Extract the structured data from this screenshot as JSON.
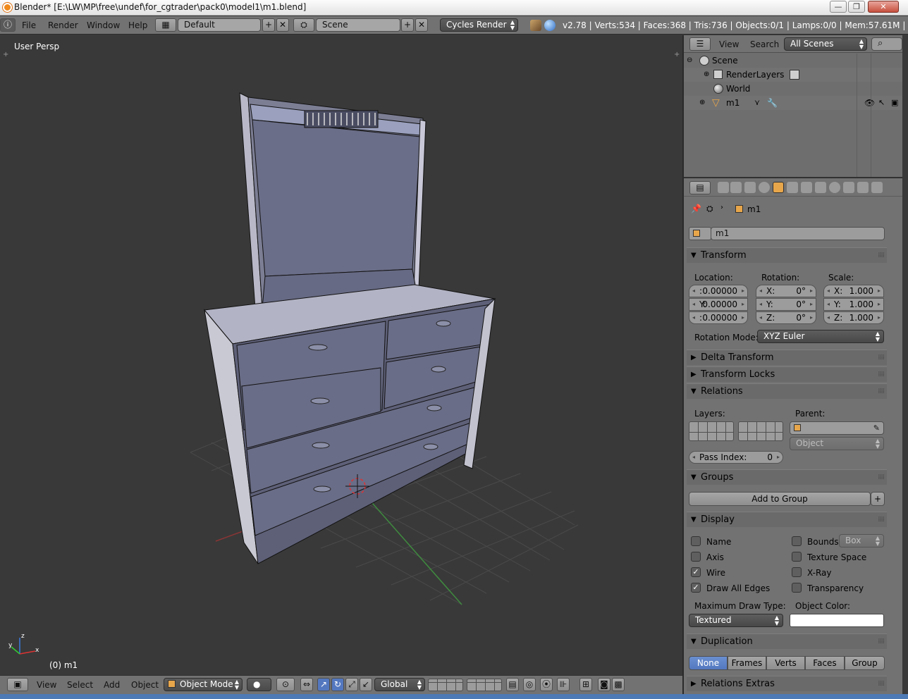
{
  "window": {
    "title": "Blender* [E:\\LW\\MP\\free\\undef\\for_cgtrader\\pack0\\model1\\m1.blend]",
    "min_label": "—",
    "max_label": "❐",
    "close_label": "✕"
  },
  "info_header": {
    "menus": [
      "File",
      "Render",
      "Window",
      "Help"
    ],
    "screen_layout": "Default",
    "scene": "Scene",
    "render_engine": "Cycles Render",
    "stats": "v2.78 | Verts:534 | Faces:368 | Tris:736 | Objects:0/1 | Lamps:0/0 | Mem:57.61M | m1"
  },
  "viewport": {
    "view_name": "User Persp",
    "object_label": "(0) m1"
  },
  "viewport_header": {
    "menus": [
      "View",
      "Select",
      "Add",
      "Object"
    ],
    "mode": "Object Mode",
    "orientation": "Global"
  },
  "outliner": {
    "menus": [
      "View",
      "Search"
    ],
    "display_mode": "All Scenes",
    "items": [
      {
        "label": "Scene"
      },
      {
        "label": "RenderLayers"
      },
      {
        "label": "World"
      },
      {
        "label": "m1"
      }
    ]
  },
  "properties": {
    "breadcrumb": "m1",
    "object_name": "m1",
    "transform": {
      "title": "Transform",
      "location_label": "Location:",
      "rotation_label": "Rotation:",
      "scale_label": "Scale:",
      "location": [
        {
          "axis": ":",
          "value": "0.00000"
        },
        {
          "axis": "Y:",
          "value": "0.00000"
        },
        {
          "axis": ":",
          "value": "0.00000"
        }
      ],
      "rotation": [
        {
          "axis": "X:",
          "value": "0°"
        },
        {
          "axis": "Y:",
          "value": "0°"
        },
        {
          "axis": "Z:",
          "value": "0°"
        }
      ],
      "scale": [
        {
          "axis": "X:",
          "value": "1.000"
        },
        {
          "axis": "Y:",
          "value": "1.000"
        },
        {
          "axis": "Z:",
          "value": "1.000"
        }
      ],
      "rotation_mode_label": "Rotation Mode:",
      "rotation_mode": "XYZ Euler"
    },
    "delta_transform": "Delta Transform",
    "transform_locks": "Transform Locks",
    "relations": {
      "title": "Relations",
      "layers_label": "Layers:",
      "parent_label": "Parent:",
      "parent_type": "Object",
      "pass_index_label": "Pass Index:",
      "pass_index": "0"
    },
    "groups": {
      "title": "Groups",
      "add_label": "Add to Group"
    },
    "display": {
      "title": "Display",
      "left": [
        {
          "label": "Name",
          "checked": false
        },
        {
          "label": "Axis",
          "checked": false
        },
        {
          "label": "Wire",
          "checked": true
        },
        {
          "label": "Draw All Edges",
          "checked": true
        }
      ],
      "right": [
        {
          "label": "Bounds",
          "checked": false
        },
        {
          "label": "Texture Space",
          "checked": false
        },
        {
          "label": "X-Ray",
          "checked": false
        },
        {
          "label": "Transparency",
          "checked": false
        }
      ],
      "bounds_type": "Box",
      "max_draw_label": "Maximum Draw Type:",
      "max_draw_type": "Textured",
      "object_color_label": "Object Color:",
      "object_color": "#ffffff"
    },
    "duplication": {
      "title": "Duplication",
      "options": [
        "None",
        "Frames",
        "Verts",
        "Faces",
        "Group"
      ],
      "selected": "None"
    },
    "relations_extras": "Relations Extras"
  },
  "colors": {
    "viewport_bg": "#393939",
    "panel_bg": "#727272",
    "selected_blue": "#5478c0",
    "accent_orange": "#f08a1c"
  }
}
